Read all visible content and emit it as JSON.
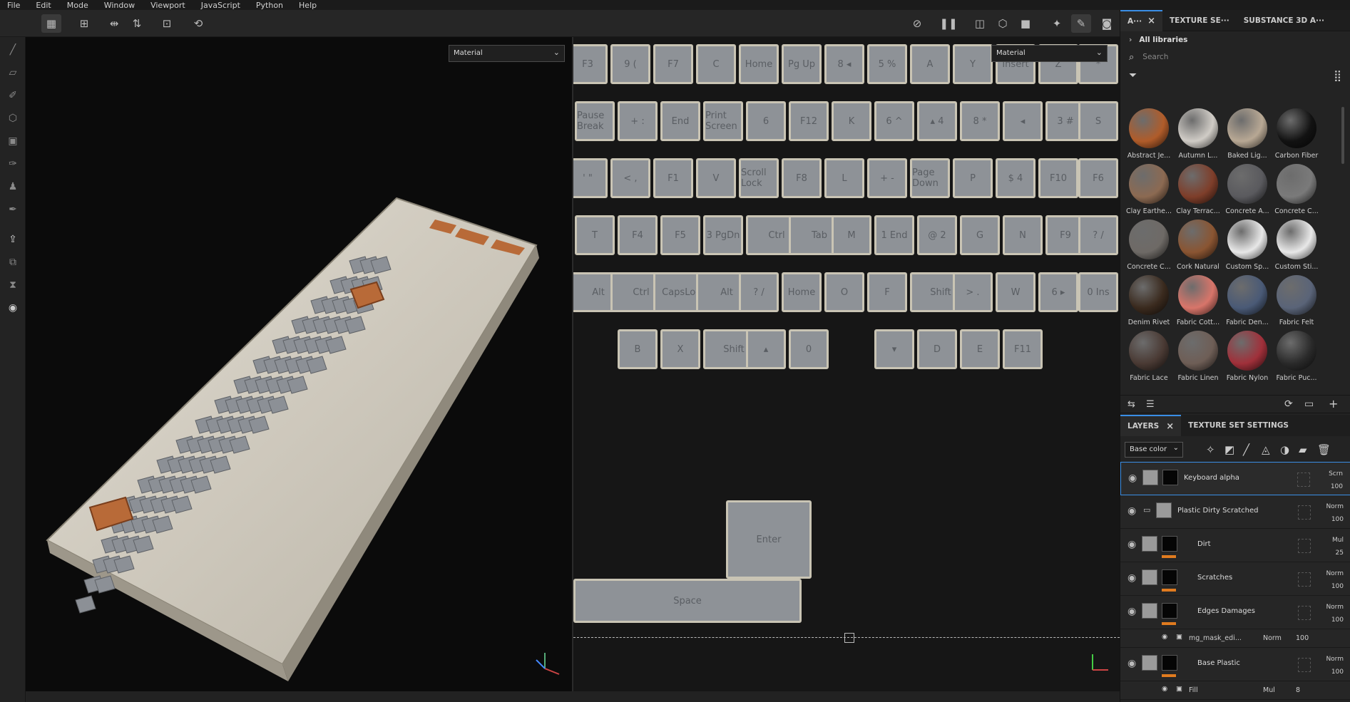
{
  "menu": [
    "File",
    "Edit",
    "Mode",
    "Window",
    "Viewport",
    "JavaScript",
    "Python",
    "Help"
  ],
  "viewport3d": {
    "mode_select": "Material"
  },
  "viewport2d": {
    "mode_select": "Material"
  },
  "keys": [
    {
      "t": "F3"
    },
    {
      "t": "9 ("
    },
    {
      "t": "F7"
    },
    {
      "t": "C"
    },
    {
      "t": "Home"
    },
    {
      "t": "Pg Up"
    },
    {
      "t": "8 ◂"
    },
    {
      "t": "5 %"
    },
    {
      "t": "A"
    },
    {
      "t": "Y"
    },
    {
      "t": "Insert"
    },
    {
      "t": "Z"
    },
    {
      "t": "*"
    },
    {
      "t": "Pause Break"
    },
    {
      "t": "+ :"
    },
    {
      "t": "End"
    },
    {
      "t": "Print Screen"
    },
    {
      "t": "6"
    },
    {
      "t": "F12"
    },
    {
      "t": "K"
    },
    {
      "t": "6 ^"
    },
    {
      "t": "▴ 4"
    },
    {
      "t": "8 *"
    },
    {
      "t": "◂"
    },
    {
      "t": "3 #"
    },
    {
      "t": "S"
    },
    {
      "t": "' \""
    },
    {
      "t": "< ,"
    },
    {
      "t": "F1"
    },
    {
      "t": "V"
    },
    {
      "t": "Scroll Lock"
    },
    {
      "t": "F8"
    },
    {
      "t": "L"
    },
    {
      "t": "+ -"
    },
    {
      "t": "Page Down"
    },
    {
      "t": "P"
    },
    {
      "t": "$ 4"
    },
    {
      "t": "F10"
    },
    {
      "t": "F6"
    },
    {
      "t": "T"
    },
    {
      "t": "F4"
    },
    {
      "t": "F5"
    },
    {
      "t": "3 PgDn"
    },
    {
      "t": "Ctrl"
    },
    {
      "t": "Tab"
    },
    {
      "t": "M"
    },
    {
      "t": "1 End"
    },
    {
      "t": "@ 2"
    },
    {
      "t": "G"
    },
    {
      "t": "N"
    },
    {
      "t": "F9"
    },
    {
      "t": "? /"
    },
    {
      "t": "Alt"
    },
    {
      "t": "Ctrl"
    },
    {
      "t": "CapsLock"
    },
    {
      "t": "Alt"
    },
    {
      "t": "? /"
    },
    {
      "t": "Home"
    },
    {
      "t": "O"
    },
    {
      "t": "F"
    },
    {
      "t": "Shift"
    },
    {
      "t": "> ."
    },
    {
      "t": "W"
    },
    {
      "t": "6 ▸"
    },
    {
      "t": "0 Ins"
    },
    {
      "t": "Enter"
    },
    {
      "t": "B"
    },
    {
      "t": "X"
    },
    {
      "t": "Shift"
    },
    {
      "t": "▴"
    },
    {
      "t": "0"
    },
    {
      "t": "Space"
    },
    {
      "t": "▾"
    },
    {
      "t": "D"
    },
    {
      "t": "E"
    },
    {
      "t": "F11"
    }
  ],
  "right_panel": {
    "tabs": [
      {
        "label": "A···",
        "closable": true
      },
      {
        "label": "TEXTURE SE···"
      },
      {
        "label": "SUBSTANCE 3D A···"
      }
    ],
    "breadcrumb": "All libraries",
    "search_placeholder": "Search",
    "materials": [
      {
        "label": "Abstract Je...",
        "color": "#b05c2a"
      },
      {
        "label": "Autumn L...",
        "color": "#d0ccc6"
      },
      {
        "label": "Baked Lig...",
        "color": "#b8a894"
      },
      {
        "label": "Carbon Fiber",
        "color": "#121212"
      },
      {
        "label": "Clay Earthe...",
        "color": "#8c6a52"
      },
      {
        "label": "Clay Terrac...",
        "color": "#7e3e2a"
      },
      {
        "label": "Concrete A...",
        "color": "#5a5a5e"
      },
      {
        "label": "Concrete C...",
        "color": "#7a7a7a"
      },
      {
        "label": "Concrete C...",
        "color": "#6e6a66"
      },
      {
        "label": "Cork Natural",
        "color": "#8a5532"
      },
      {
        "label": "Custom Sp...",
        "color": "#e8e8e8"
      },
      {
        "label": "Custom Sti...",
        "color": "#e8e8e8"
      },
      {
        "label": "Denim Rivet",
        "color": "#3a2a1e"
      },
      {
        "label": "Fabric Cott...",
        "color": "#d8756a"
      },
      {
        "label": "Fabric Den...",
        "color": "#4a5a76"
      },
      {
        "label": "Fabric Felt",
        "color": "#5a6478"
      },
      {
        "label": "Fabric Lace",
        "color": "#4a3a34"
      },
      {
        "label": "Fabric Linen",
        "color": "#6e5e56"
      },
      {
        "label": "Fabric Nylon",
        "color": "#a0303a"
      },
      {
        "label": "Fabric Puc...",
        "color": "#2a2a2a"
      }
    ],
    "layers_tabs": [
      {
        "label": "LAYERS",
        "closable": true
      },
      {
        "label": "TEXTURE SET SETTINGS"
      }
    ],
    "channel": "Base color",
    "layers": [
      {
        "name": "Keyboard alpha",
        "blend": "Scrn",
        "opacity": "100",
        "selected": true
      },
      {
        "name": "Plastic Dirty Scratched",
        "blend": "Norm",
        "opacity": "100",
        "folder": true
      },
      {
        "name": "Dirt",
        "blend": "Mul",
        "opacity": "25"
      },
      {
        "name": "Scratches",
        "blend": "Norm",
        "opacity": "100"
      },
      {
        "name": "Edges Damages",
        "blend": "Norm",
        "opacity": "100"
      },
      {
        "name": "mg_mask_edi...",
        "blend": "Norm",
        "opacity": "100",
        "sub": true
      },
      {
        "name": "Base Plastic",
        "blend": "Norm",
        "opacity": "100"
      },
      {
        "name": "Fill",
        "blend": "Mul",
        "opacity": "8",
        "sub": true
      }
    ]
  }
}
